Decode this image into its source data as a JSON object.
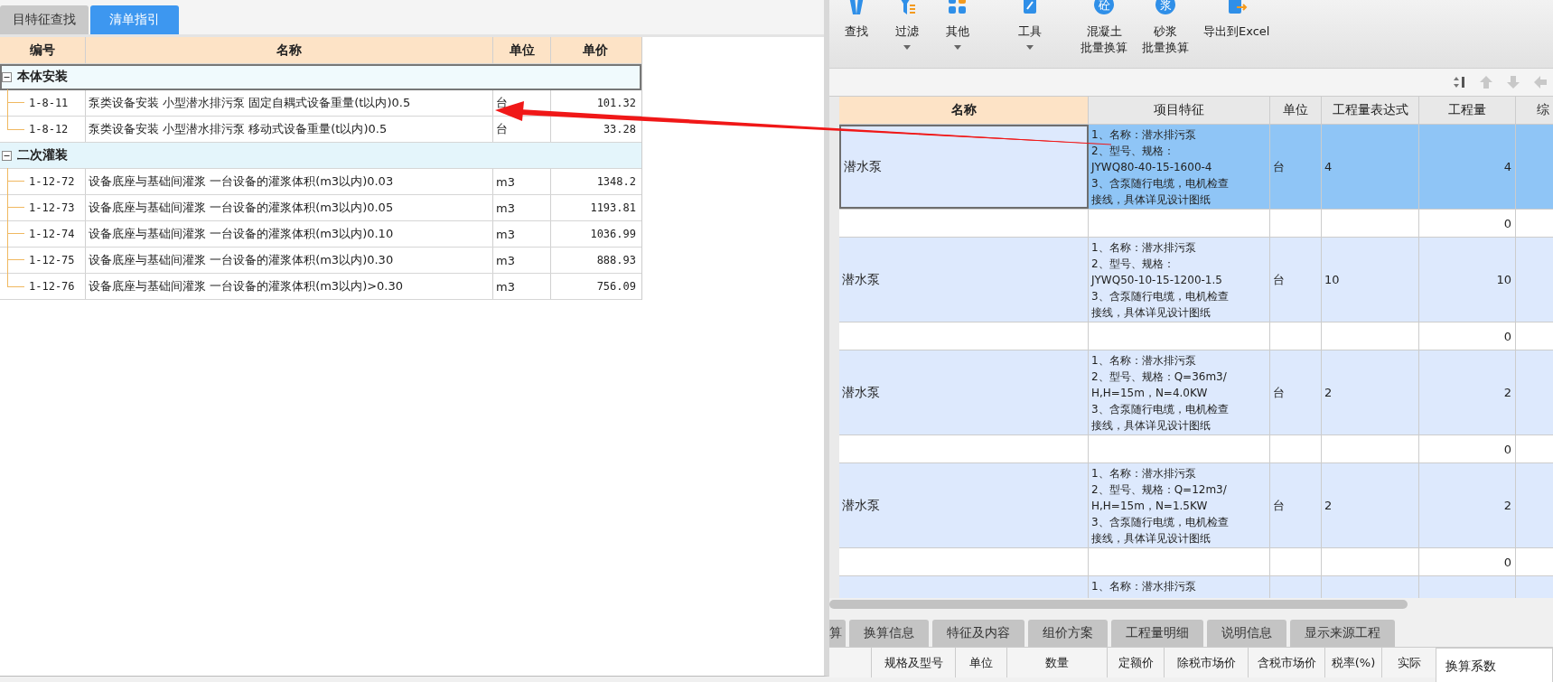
{
  "left_panel": {
    "tabs": [
      {
        "label": "目特征查找",
        "selected": false
      },
      {
        "label": "清单指引",
        "selected": true
      }
    ],
    "table": {
      "columns": [
        "编号",
        "名称",
        "单位",
        "单价"
      ],
      "groups": [
        {
          "name": "本体安装",
          "expanded": true,
          "selected": true,
          "children": [
            {
              "code": "1-8-11",
              "name": "泵类设备安装 小型潜水排污泵 固定自耦式设备重量(t以内)0.5",
              "unit": "台",
              "price": "101.32"
            },
            {
              "code": "1-8-12",
              "name": "泵类设备安装 小型潜水排污泵 移动式设备重量(t以内)0.5",
              "unit": "台",
              "price": "33.28"
            }
          ]
        },
        {
          "name": "二次灌装",
          "expanded": true,
          "selected": false,
          "children": [
            {
              "code": "1-12-72",
              "name": "设备底座与基础间灌浆 一台设备的灌浆体积(m3以内)0.03",
              "unit": "m3",
              "price": "1348.2"
            },
            {
              "code": "1-12-73",
              "name": "设备底座与基础间灌浆 一台设备的灌浆体积(m3以内)0.05",
              "unit": "m3",
              "price": "1193.81"
            },
            {
              "code": "1-12-74",
              "name": "设备底座与基础间灌浆 一台设备的灌浆体积(m3以内)0.10",
              "unit": "m3",
              "price": "1036.99"
            },
            {
              "code": "1-12-75",
              "name": "设备底座与基础间灌浆 一台设备的灌浆体积(m3以内)0.30",
              "unit": "m3",
              "price": "888.93"
            },
            {
              "code": "1-12-76",
              "name": "设备底座与基础间灌浆 一台设备的灌浆体积(m3以内)>0.30",
              "unit": "m3",
              "price": "756.09"
            }
          ]
        }
      ]
    }
  },
  "toolbar": {
    "items": [
      {
        "kind": "search",
        "label": "查找",
        "dropdown": false
      },
      {
        "kind": "filter",
        "label": "过滤",
        "dropdown": true
      },
      {
        "kind": "grid",
        "label": "其他",
        "dropdown": true
      },
      {
        "kind": "tool",
        "label": "工具",
        "dropdown": true
      },
      {
        "kind": "circle",
        "label": "混凝土",
        "label_2": "批量换算",
        "dropdown": false,
        "glyph": "砼"
      },
      {
        "kind": "circle",
        "label": "砂浆",
        "label_2": "批量换算",
        "dropdown": false,
        "glyph": "浆"
      },
      {
        "kind": "export",
        "label": "导出到Excel",
        "dropdown": false
      }
    ]
  },
  "grid": {
    "columns": [
      "名称",
      "项目特征",
      "单位",
      "工程量表达式",
      "工程量",
      "综"
    ],
    "rows": [
      {
        "kind": "item",
        "selected": true,
        "name": "潜水泵",
        "features": [
          "1、名称：潜水排污泵",
          "2、型号、规格：",
          "JYWQ80-40-15-1600-4",
          "3、含泵随行电缆，电机检查",
          "接线，具体详见设计图纸"
        ],
        "unit": "台",
        "expression": "4",
        "quantity": "4"
      },
      {
        "kind": "sub",
        "quantity": "0"
      },
      {
        "kind": "item",
        "selected": false,
        "name": "潜水泵",
        "features": [
          "1、名称：潜水排污泵",
          "2、型号、规格：",
          "JYWQ50-10-15-1200-1.5",
          "3、含泵随行电缆，电机检查",
          "接线，具体详见设计图纸"
        ],
        "unit": "台",
        "expression": "10",
        "quantity": "10"
      },
      {
        "kind": "sub",
        "quantity": "0"
      },
      {
        "kind": "item",
        "selected": false,
        "name": "潜水泵",
        "features": [
          "1、名称：潜水排污泵",
          "2、型号、规格：Q=36m3/",
          "H,H=15m，N=4.0KW",
          "3、含泵随行电缆，电机检查",
          "接线，具体详见设计图纸"
        ],
        "unit": "台",
        "expression": "2",
        "quantity": "2"
      },
      {
        "kind": "sub",
        "quantity": "0"
      },
      {
        "kind": "item",
        "selected": false,
        "name": "潜水泵",
        "features": [
          "1、名称：潜水排污泵",
          "2、型号、规格：Q=12m3/",
          "H,H=15m，N=1.5KW",
          "3、含泵随行电缆，电机检查",
          "接线，具体详见设计图纸"
        ],
        "unit": "台",
        "expression": "2",
        "quantity": "2"
      },
      {
        "kind": "sub",
        "quantity": "0"
      },
      {
        "kind": "partial",
        "features": [
          "1、名称：潜水排污泵"
        ]
      }
    ]
  },
  "bottom_tabs": [
    {
      "label": "算",
      "selected": false
    },
    {
      "label": "换算信息",
      "selected": false
    },
    {
      "label": "特征及内容",
      "selected": false
    },
    {
      "label": "组价方案",
      "selected": false
    },
    {
      "label": "工程量明细",
      "selected": false
    },
    {
      "label": "说明信息",
      "selected": false
    },
    {
      "label": "显示来源工程",
      "selected": false
    }
  ],
  "bottom_columns": [
    "规格及型号",
    "单位",
    "数量",
    "定额价",
    "除税市场价",
    "含税市场价",
    "税率(%)",
    "实际"
  ],
  "side_panel": {
    "title": "换算系数"
  }
}
